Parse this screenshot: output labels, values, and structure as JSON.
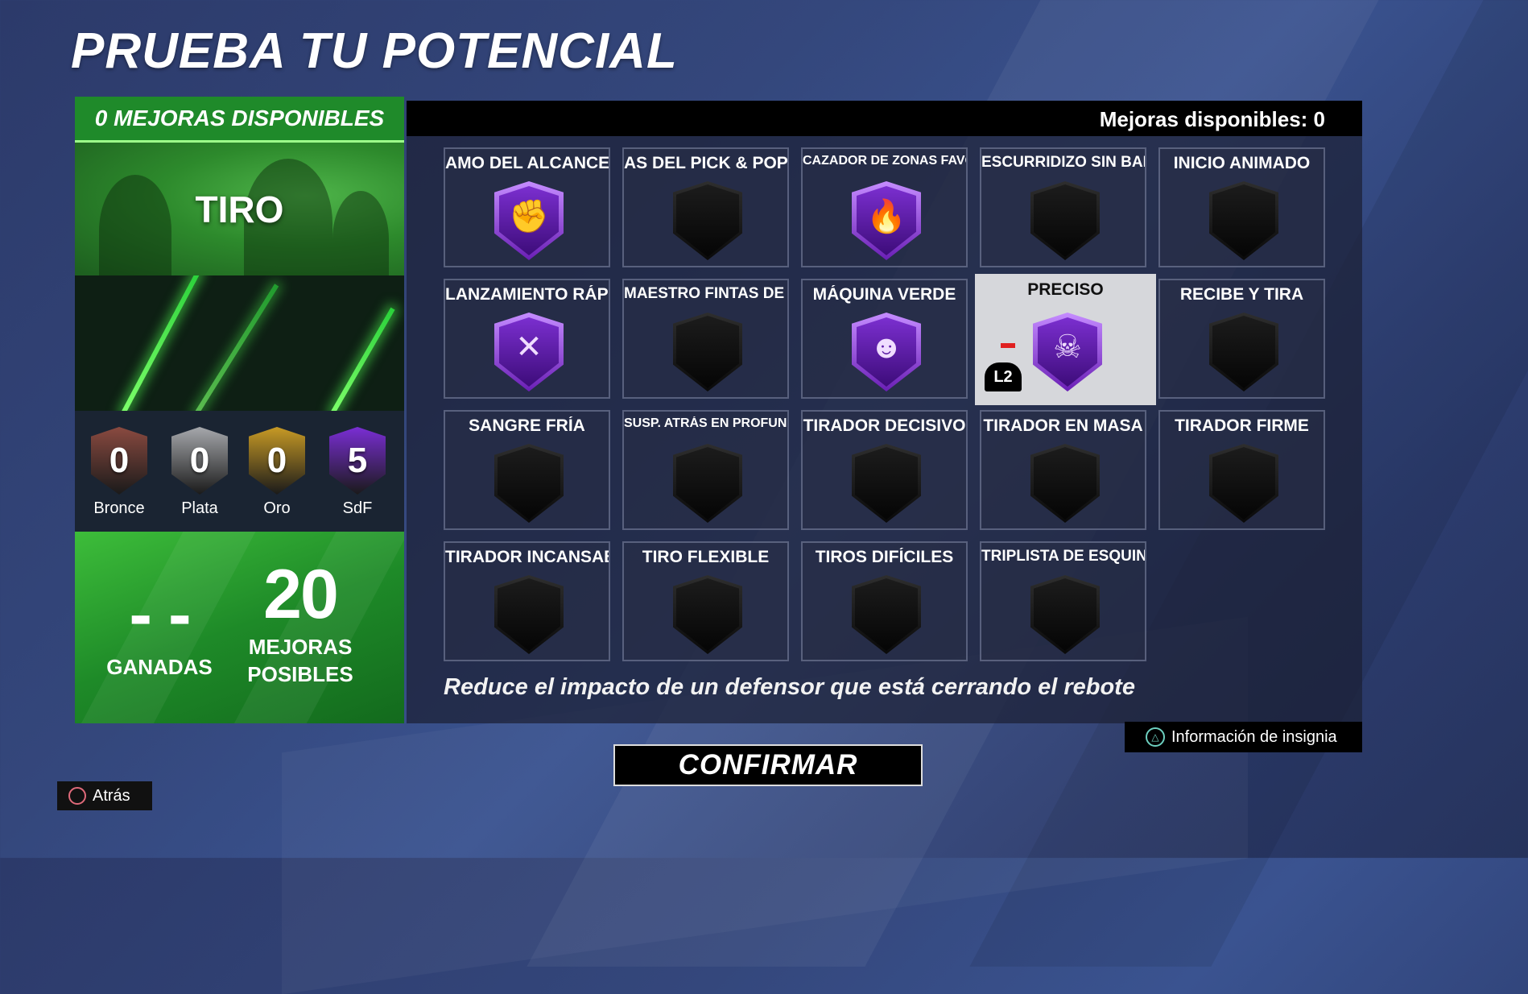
{
  "title": "PRUEBA TU POTENCIAL",
  "left_panel": {
    "header": "0 MEJORAS DISPONIBLES",
    "category": "TIRO",
    "tiers": [
      {
        "count": "0",
        "label": "Bronce",
        "color": "#8a4a40"
      },
      {
        "count": "0",
        "label": "Plata",
        "color": "#a6a8ac"
      },
      {
        "count": "0",
        "label": "Oro",
        "color": "#c79a25"
      },
      {
        "count": "5",
        "label": "SdF",
        "color": "#7a2ed4"
      }
    ],
    "stats": [
      {
        "value": "- -",
        "label": "GANADAS"
      },
      {
        "value": "20",
        "label": "MEJORAS POSIBLES"
      }
    ]
  },
  "grid": {
    "header": "Mejoras disponibles: 0",
    "badges": [
      {
        "name": "AMO DEL ALCANCE",
        "state": "hof",
        "icon": "hand-roll-icon",
        "glyph": "✊"
      },
      {
        "name": "AS DEL PICK & POP",
        "state": "empty"
      },
      {
        "name": "CAZADOR DE ZONAS FAVORABLES",
        "state": "hof",
        "icon": "flaming-hoop-icon",
        "glyph": "🔥"
      },
      {
        "name": "ESCURRIDIZO SIN BALÓN",
        "state": "empty"
      },
      {
        "name": "INICIO ANIMADO",
        "state": "empty"
      },
      {
        "name": "LANZAMIENTO RÁPIDO",
        "state": "hof",
        "icon": "playbook-icon",
        "glyph": "✕"
      },
      {
        "name": "MAESTRO FINTAS DE TIRO",
        "state": "empty"
      },
      {
        "name": "MÁQUINA VERDE",
        "state": "hof",
        "icon": "robot-icon",
        "glyph": "☻"
      },
      {
        "name": "PRECISO",
        "state": "hof",
        "selected": true,
        "icon": "crosshair-skull-icon",
        "glyph": "☠",
        "button_hint": "L2"
      },
      {
        "name": "RECIBE Y TIRA",
        "state": "empty"
      },
      {
        "name": "SANGRE FRÍA",
        "state": "empty"
      },
      {
        "name": "SUSP. ATRÁS EN PROFUNDIDAD",
        "state": "empty"
      },
      {
        "name": "TIRADOR DECISIVO",
        "state": "empty"
      },
      {
        "name": "TIRADOR EN MASA",
        "state": "empty"
      },
      {
        "name": "TIRADOR FIRME",
        "state": "empty"
      },
      {
        "name": "TIRADOR INCANSABLE",
        "state": "empty"
      },
      {
        "name": "TIRO FLEXIBLE",
        "state": "empty"
      },
      {
        "name": "TIROS DIFÍCILES",
        "state": "empty"
      },
      {
        "name": "TRIPLISTA DE ESQUINA",
        "state": "empty"
      }
    ],
    "description": "Reduce el impacto de un defensor que está cerrando el rebote"
  },
  "buttons": {
    "info": "Información de insignia",
    "confirm": "CONFIRMAR",
    "back": "Atrás"
  }
}
